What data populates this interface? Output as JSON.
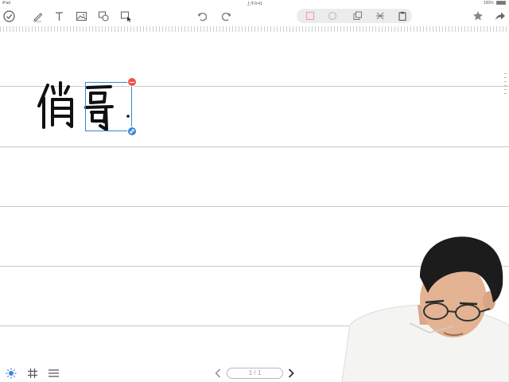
{
  "status_bar": {
    "carrier": "iPad",
    "time": "上午9:41",
    "battery": "100%"
  },
  "toolbar": {
    "left_tools": [
      "done-icon",
      "pen-icon",
      "text-icon",
      "image-icon",
      "shapes-icon",
      "lasso-select-icon"
    ],
    "history": [
      "undo-icon",
      "redo-icon"
    ],
    "selection_actions": [
      "color-square-icon",
      "color-circle-icon",
      "duplicate-icon",
      "cut-icon",
      "paste-icon"
    ],
    "right_tools": [
      "star-icon",
      "share-icon"
    ],
    "accent_color": "#3a85d6",
    "delete_color": "#f05545"
  },
  "canvas": {
    "handwriting": "俏哥.",
    "selected_glyph": "哥"
  },
  "bottom_bar": {
    "page_indicator": "1 / 1",
    "left_tools": [
      "brightness-icon",
      "grid-icon",
      "menu-icon"
    ]
  }
}
